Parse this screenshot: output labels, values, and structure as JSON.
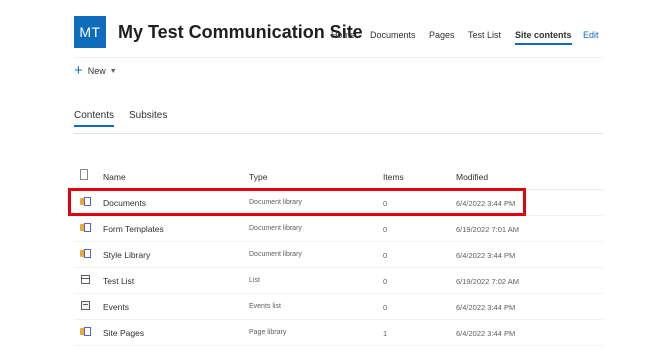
{
  "site": {
    "logo_initials": "MT",
    "title": "My Test Communication Site"
  },
  "nav": {
    "home": "Home",
    "documents": "Documents",
    "pages": "Pages",
    "test_list": "Test List",
    "site_contents": "Site contents",
    "edit": "Edit"
  },
  "command_bar": {
    "new_label": "New"
  },
  "pivot": {
    "contents": "Contents",
    "subsites": "Subsites"
  },
  "table": {
    "headers": {
      "name": "Name",
      "type": "Type",
      "items": "Items",
      "modified": "Modified"
    },
    "rows": [
      {
        "name": "Documents",
        "type": "Document library",
        "items": "0",
        "modified": "6/4/2022 3:44 PM",
        "icon": "document-library-icon"
      },
      {
        "name": "Form Templates",
        "type": "Document library",
        "items": "0",
        "modified": "6/19/2022 7:01 AM",
        "icon": "document-library-icon"
      },
      {
        "name": "Style Library",
        "type": "Document library",
        "items": "0",
        "modified": "6/4/2022 3:44 PM",
        "icon": "document-library-icon"
      },
      {
        "name": "Test List",
        "type": "List",
        "items": "0",
        "modified": "6/19/2022 7:02 AM",
        "icon": "list-icon"
      },
      {
        "name": "Events",
        "type": "Events list",
        "items": "0",
        "modified": "6/4/2022 3:44 PM",
        "icon": "events-list-icon"
      },
      {
        "name": "Site Pages",
        "type": "Page library",
        "items": "1",
        "modified": "6/4/2022 3:44 PM",
        "icon": "page-library-icon"
      }
    ]
  },
  "colors": {
    "accent": "#0f6cbd",
    "highlight": "#e3000f",
    "library_folder": "#e8a93b"
  }
}
